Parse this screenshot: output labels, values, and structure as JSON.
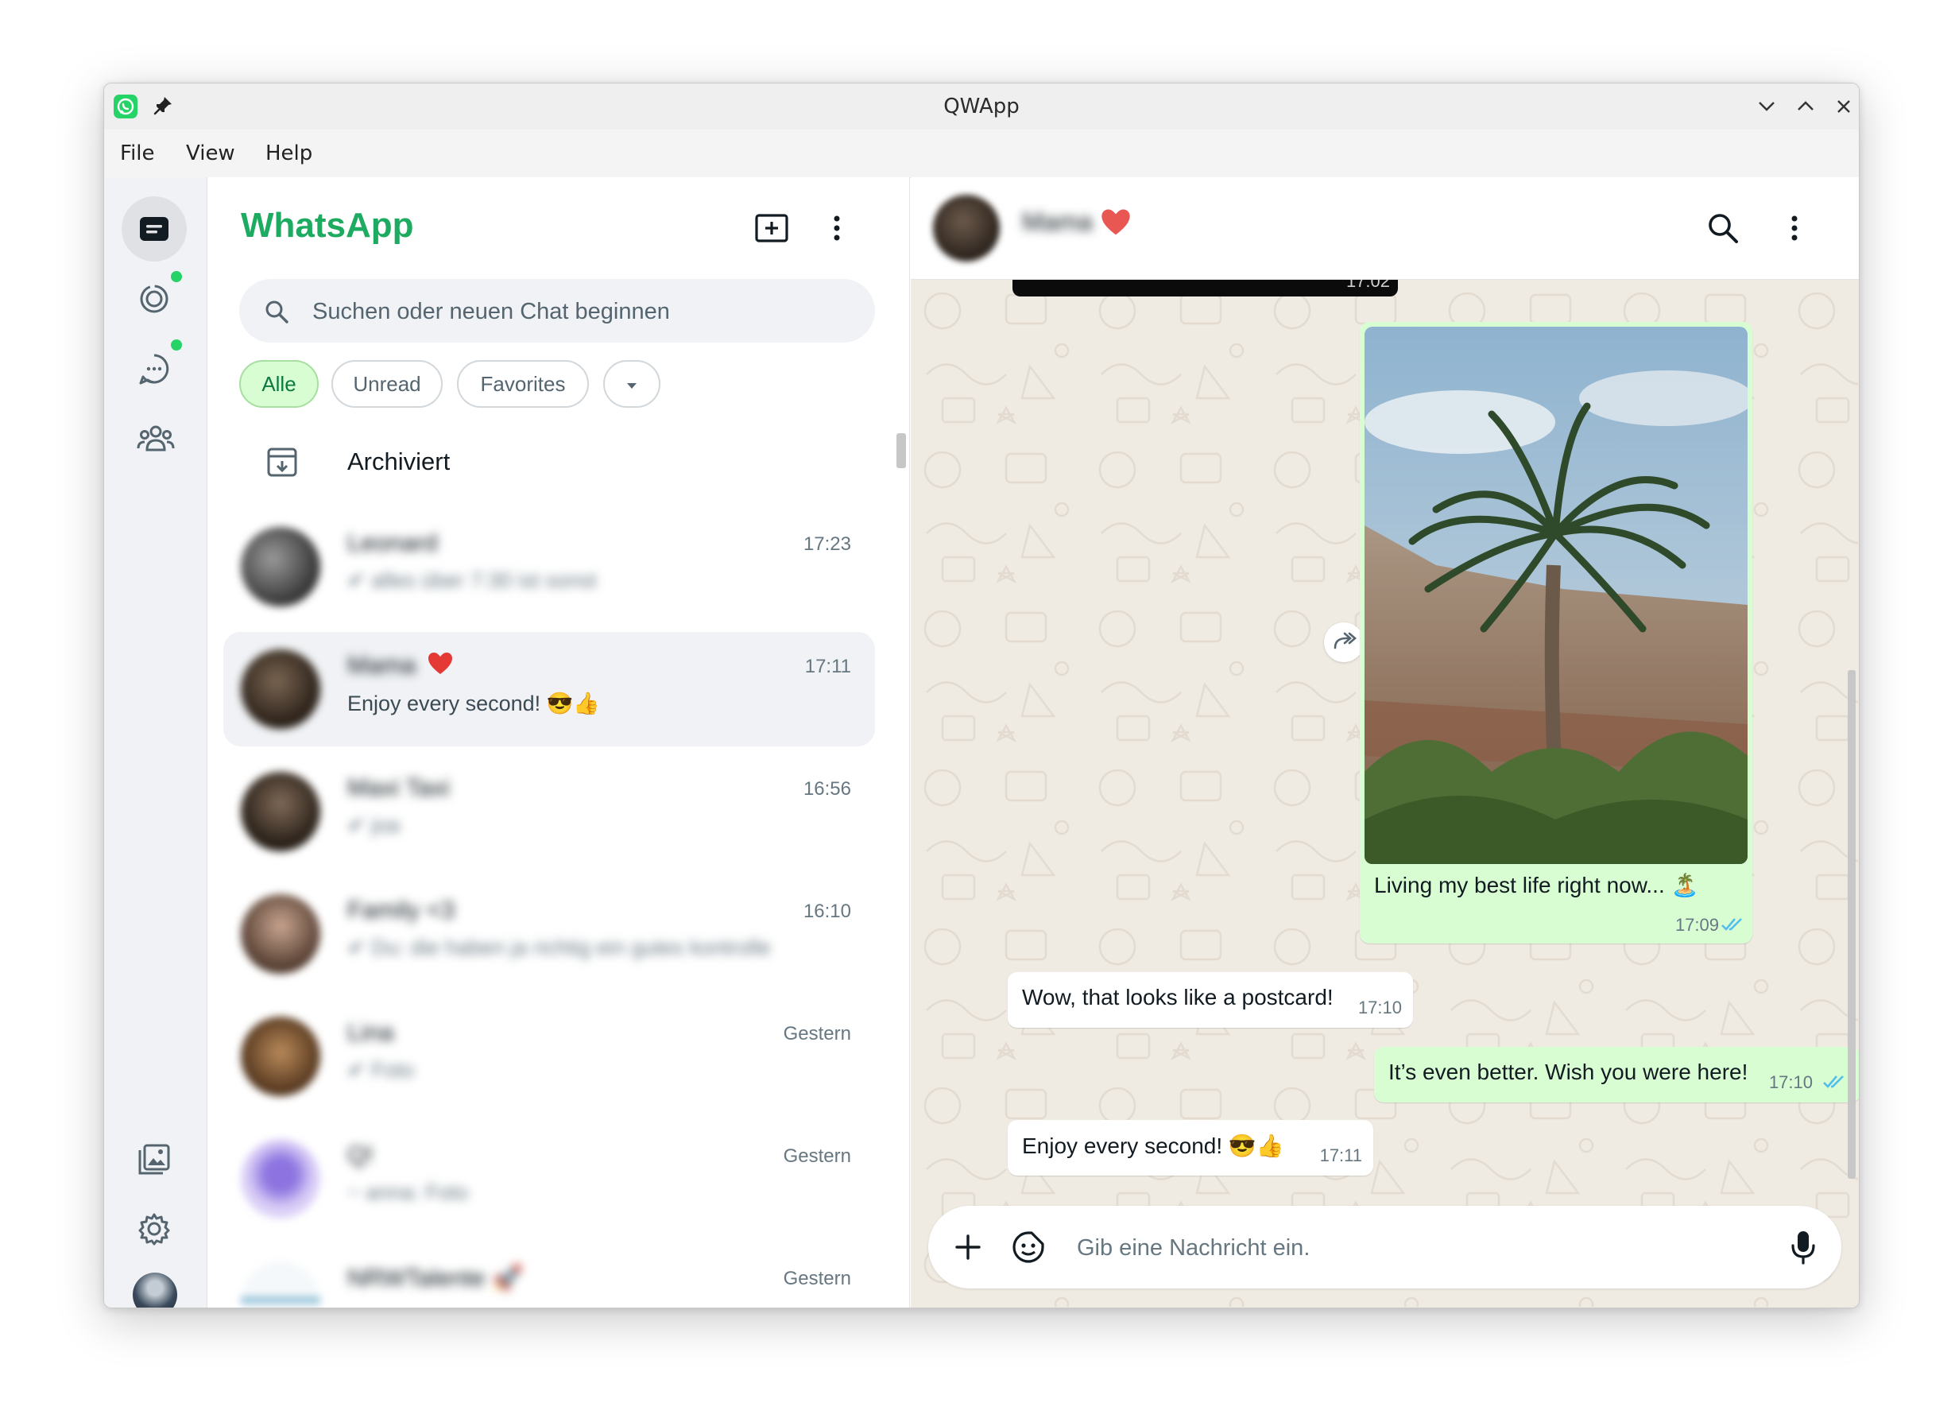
{
  "window": {
    "title": "QWApp"
  },
  "menu": {
    "file": "File",
    "view": "View",
    "help": "Help"
  },
  "rail": {
    "top_items": [
      {
        "name": "chats",
        "icon": "chats-icon",
        "active": true
      },
      {
        "name": "status",
        "icon": "status-icon",
        "badge": true
      },
      {
        "name": "channels",
        "icon": "channels-icon",
        "badge": true
      },
      {
        "name": "communities",
        "icon": "communities-icon"
      }
    ],
    "bottom_items": [
      "media-icon",
      "settings-icon",
      "profile-avatar"
    ]
  },
  "sidebar": {
    "brand": "WhatsApp",
    "brand_color": "#1daa61",
    "search_placeholder": "Suchen oder neuen Chat beginnen",
    "filters": {
      "all": "Alle",
      "unread": "Unread",
      "favorites": "Favorites"
    },
    "archived_label": "Archiviert",
    "chats": [
      {
        "name": "Leonard",
        "time": "17:23",
        "preview": "✔ alles über 7:30 ist sonst",
        "avatar_color": "#4a4a4a"
      },
      {
        "name": "Mama",
        "time": "17:11",
        "preview": "Enjoy every second! 😎👍",
        "selected": true,
        "avatar_color": "#3e2e22"
      },
      {
        "name": "Maxi Taxi",
        "time": "16:56",
        "preview": "✔ joa",
        "avatar_color": "#3b2a20"
      },
      {
        "name": "Family <3",
        "time": "16:10",
        "preview": "✔ Du: die haben ja richtig ein gutes kontrolle",
        "avatar_color": "#6b5040"
      },
      {
        "name": "Lina",
        "time": "Gestern",
        "preview": "✔ Foto",
        "avatar_color": "#8a5a34"
      },
      {
        "name": "Q!",
        "time": "Gestern",
        "preview": "~ anna: Foto",
        "avatar_color": "#c9b8f0"
      },
      {
        "name": "NRWTalente 🚀",
        "time": "Gestern",
        "preview": "",
        "avatar_color": "#e8f2f6"
      }
    ]
  },
  "conversation": {
    "contact_name": "Mama",
    "top_partial_time": "17:02",
    "messages": [
      {
        "dir": "out",
        "type": "image",
        "caption": "Living my best life right now... 🏝️",
        "time": "17:09",
        "read": true
      },
      {
        "dir": "in",
        "text": "Wow, that looks like a postcard!",
        "time": "17:10"
      },
      {
        "dir": "out",
        "text": "It’s even better. Wish you were here!",
        "time": "17:10",
        "read": true
      },
      {
        "dir": "in",
        "text": "Enjoy every second! 😎👍",
        "time": "17:11"
      }
    ],
    "composer_placeholder": "Gib eine Nachricht ein."
  },
  "colors": {
    "accent": "#1daa61",
    "outgoing_bubble": "#d9fdd3",
    "read_ticks": "#53bdeb",
    "chat_bg": "#efeae2"
  }
}
